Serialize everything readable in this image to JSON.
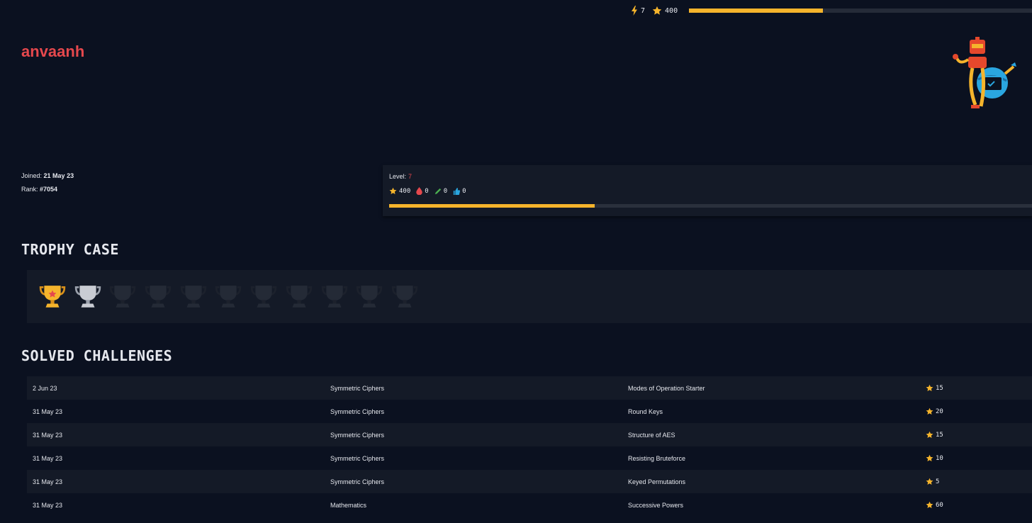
{
  "topbar": {
    "streak": "7",
    "points": "400",
    "xp_progress": 0.39
  },
  "profile": {
    "username": "anvaanh",
    "joined_label": "Joined:",
    "joined": "21 May 23",
    "rank_label": "Rank:",
    "rank": "#7054"
  },
  "level": {
    "label": "Level:",
    "value": "7",
    "points": "400",
    "bloods": "0",
    "posts": "0",
    "likes": "0",
    "progress": 0.32
  },
  "trophy_case": {
    "title": "TROPHY CASE",
    "trophies": [
      {
        "state": "gold"
      },
      {
        "state": "silver"
      },
      {
        "state": "locked"
      },
      {
        "state": "locked"
      },
      {
        "state": "locked"
      },
      {
        "state": "locked"
      },
      {
        "state": "locked"
      },
      {
        "state": "locked"
      },
      {
        "state": "locked"
      },
      {
        "state": "locked"
      },
      {
        "state": "locked"
      }
    ]
  },
  "solved": {
    "title": "SOLVED CHALLENGES",
    "rows": [
      {
        "date": "2 Jun 23",
        "category": "Symmetric Ciphers",
        "name": "Modes of Operation Starter",
        "points": "15"
      },
      {
        "date": "31 May 23",
        "category": "Symmetric Ciphers",
        "name": "Round Keys",
        "points": "20"
      },
      {
        "date": "31 May 23",
        "category": "Symmetric Ciphers",
        "name": "Structure of AES",
        "points": "15"
      },
      {
        "date": "31 May 23",
        "category": "Symmetric Ciphers",
        "name": "Resisting Bruteforce",
        "points": "10"
      },
      {
        "date": "31 May 23",
        "category": "Symmetric Ciphers",
        "name": "Keyed Permutations",
        "points": "5"
      },
      {
        "date": "31 May 23",
        "category": "Mathematics",
        "name": "Successive Powers",
        "points": "60"
      }
    ]
  },
  "colors": {
    "accent": "#f5b42c",
    "brand_red": "#e5484d",
    "background": "#0b1120",
    "panel": "#141a27"
  }
}
